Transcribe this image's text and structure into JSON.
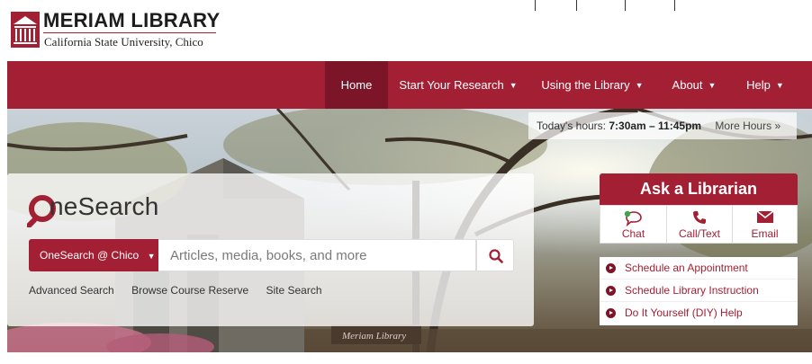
{
  "branding": {
    "title": "MERIAM LIBRARY",
    "subtitle": "California State University, Chico",
    "accent": "#a31f34"
  },
  "nav": {
    "items": [
      {
        "label": "Home",
        "active": true,
        "dropdown": false
      },
      {
        "label": "Start Your Research",
        "active": false,
        "dropdown": true
      },
      {
        "label": "Using the Library",
        "active": false,
        "dropdown": true
      },
      {
        "label": "About",
        "active": false,
        "dropdown": true
      },
      {
        "label": "Help",
        "active": false,
        "dropdown": true
      }
    ]
  },
  "hours": {
    "prefix": "Today's hours:",
    "value": "7:30am – 11:45pm",
    "more_label": "More Hours »"
  },
  "search": {
    "brand_rest": "neSearch",
    "scope_label": "OneSearch @ Chico",
    "placeholder": "Articles, media, books, and more",
    "links": [
      "Advanced Search",
      "Browse Course Reserve",
      "Site Search"
    ]
  },
  "ask": {
    "title": "Ask a Librarian",
    "channels": [
      {
        "label": "Chat",
        "icon": "chat-icon"
      },
      {
        "label": "Call/Text",
        "icon": "phone-icon"
      },
      {
        "label": "Email",
        "icon": "envelope-icon"
      }
    ],
    "links": [
      "Schedule an Appointment",
      "Schedule Library Instruction",
      "Do It Yourself (DIY) Help"
    ]
  },
  "hero": {
    "sign_text": "Meriam Library"
  }
}
